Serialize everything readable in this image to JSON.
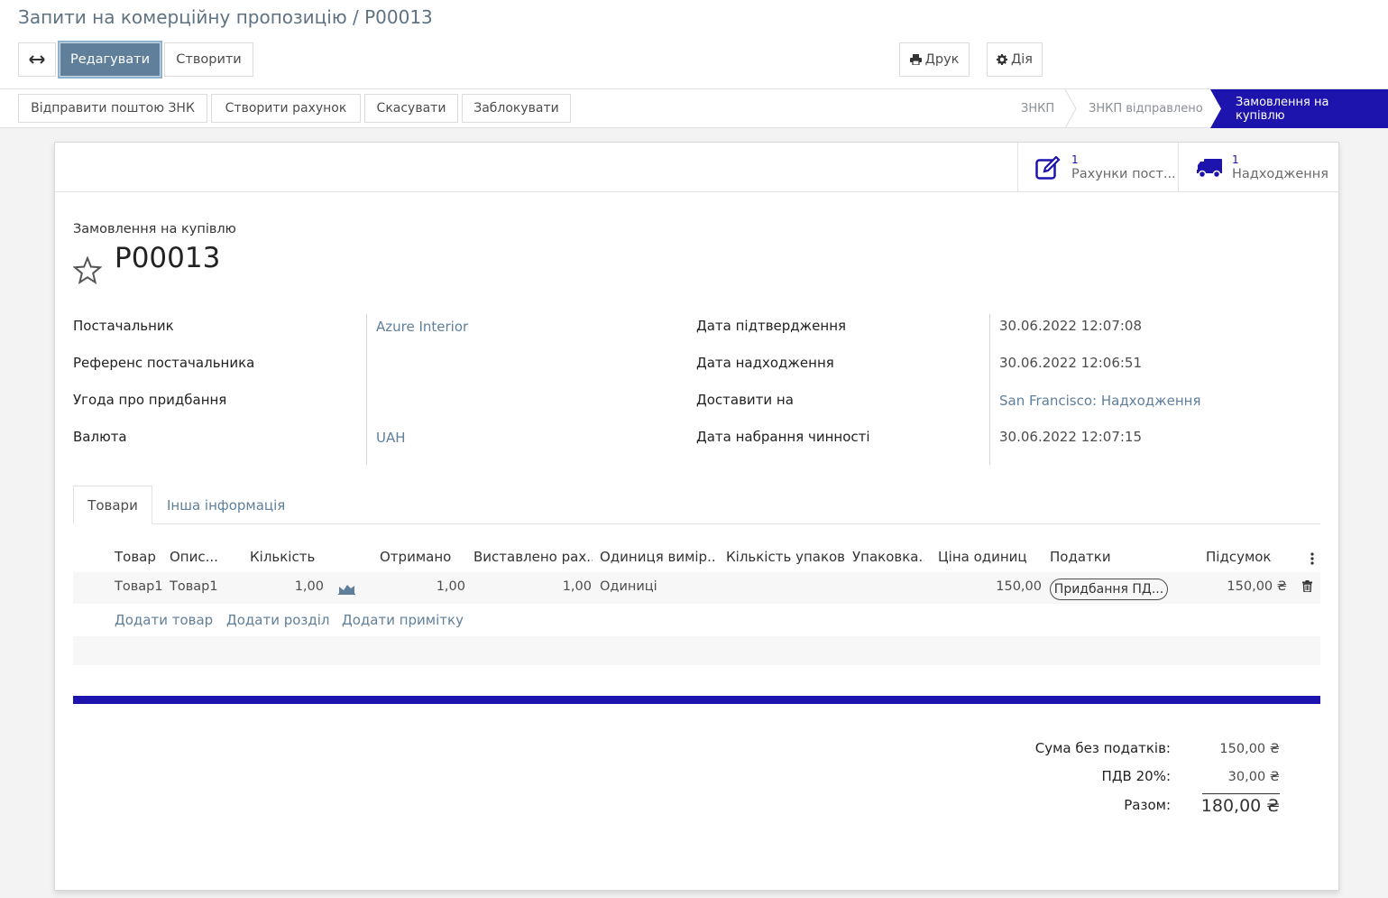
{
  "breadcrumb": "Запити на комерційну пропозицію / P00013",
  "toolbar": {
    "expand_icon": "arrows-h-icon",
    "edit_label": "Редагувати",
    "create_label": "Створити",
    "print_label": "Друк",
    "action_label": "Дія"
  },
  "status_actions": {
    "send_email": "Відправити поштою ЗНК",
    "create_bill": "Створити рахунок",
    "cancel": "Скасувати",
    "lock": "Заблокувати"
  },
  "stages": [
    "ЗНКП",
    "ЗНКП відправлено",
    "Замовлення на купівлю"
  ],
  "active_stage": "Замовлення на купівлю",
  "smart_buttons": [
    {
      "count": "1",
      "label": "Рахунки пост...",
      "icon": "edit-icon"
    },
    {
      "count": "1",
      "label": "Надходження",
      "icon": "truck-icon"
    }
  ],
  "document": {
    "type_label": "Замовлення на купівлю",
    "name": "P00013"
  },
  "fields_left": [
    {
      "label": "Постачальник",
      "value": "Azure Interior"
    },
    {
      "label": "Референс постачальника",
      "value": ""
    },
    {
      "label": "Угода про придбання",
      "value": ""
    },
    {
      "label": "Валюта",
      "value": "UAH"
    }
  ],
  "fields_right": [
    {
      "label": "Дата підтвердження",
      "value": "30.06.2022 12:07:08"
    },
    {
      "label": "Дата надходження",
      "value": "30.06.2022 12:06:51"
    },
    {
      "label": "Доставити на",
      "value": "San Francisco: Надходження"
    },
    {
      "label": "Дата набрання чинності",
      "value": "30.06.2022 12:07:15"
    }
  ],
  "tabs": [
    "Товари",
    "Інша інформація"
  ],
  "table": {
    "columns": [
      "Товар",
      "Опис...",
      "Кількість",
      "Отримано",
      "Виставлено рах...",
      "Одиниця вимір...",
      "Кількість упаков...",
      "Упаковка...",
      "Ціна одиниці",
      "Податки",
      "Підсумок"
    ],
    "row": {
      "product": "Товар1",
      "description": "Товар1",
      "quantity": "1,00",
      "received": "1,00",
      "invoiced": "1,00",
      "uom": "Одиниці",
      "packaging_qty": "",
      "packaging": "",
      "price_unit": "150,00",
      "tax": "Придбання ПД...",
      "subtotal": "150,00 ₴"
    },
    "add_product": "Додати товар",
    "add_section": "Додати розділ",
    "add_note": "Додати примітку"
  },
  "totals": {
    "untaxed_label": "Сума без податків:",
    "untaxed_value": "150,00 ₴",
    "vat_label": "ПДВ 20%:",
    "vat_value": "30,00 ₴",
    "total_label": "Разом:",
    "total_value": "180,00 ₴"
  },
  "colors": {
    "primary": "#5f7f9b",
    "accent": "#1d13ad"
  }
}
